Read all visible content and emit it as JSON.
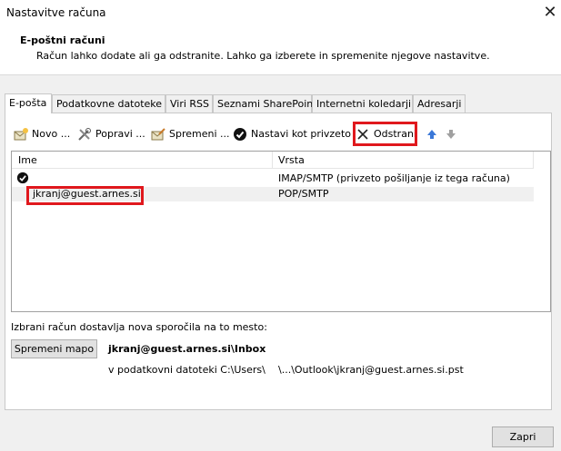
{
  "window": {
    "title": "Nastavitve računa"
  },
  "header": {
    "title": "E-poštni računi",
    "description": "Račun lahko dodate ali ga odstranite. Lahko ga izberete in spremenite njegove nastavitve."
  },
  "tabs": [
    {
      "label": "E-pošta",
      "active": true
    },
    {
      "label": "Podatkovne datoteke"
    },
    {
      "label": "Viri RSS"
    },
    {
      "label": "Seznami SharePoint"
    },
    {
      "label": "Internetni koledarji"
    },
    {
      "label": "Adresarji"
    }
  ],
  "toolbar": {
    "new_label": "Novo ...",
    "repair_label": "Popravi ...",
    "change_label": "Spremeni ...",
    "default_label": "Nastavi kot privzeto",
    "remove_label": "Odstrani"
  },
  "list": {
    "columns": {
      "name": "Ime",
      "type": "Vrsta"
    },
    "rows": [
      {
        "name": "",
        "type": "IMAP/SMTP (privzeto pošiljanje iz tega računa)",
        "is_default": true
      },
      {
        "name": "jkranj@guest.arnes.si",
        "type": "POP/SMTP",
        "selected": true
      }
    ]
  },
  "delivery": {
    "label": "Izbrani račun dostavlja nova sporočila na to mesto:",
    "change_folder_label": "Spremeni mapo",
    "folder": "jkranj@guest.arnes.si\\Inbox",
    "path_prefix": "v podatkovni datoteki C:\\Users\\",
    "path_suffix": "\\...\\Outlook\\jkranj@guest.arnes.si.pst"
  },
  "footer": {
    "close_label": "Zapri"
  },
  "colors": {
    "highlight_red": "#e0181d",
    "arrow_up_blue": "#3b78d8",
    "arrow_down_gray": "#a0a0a0"
  }
}
